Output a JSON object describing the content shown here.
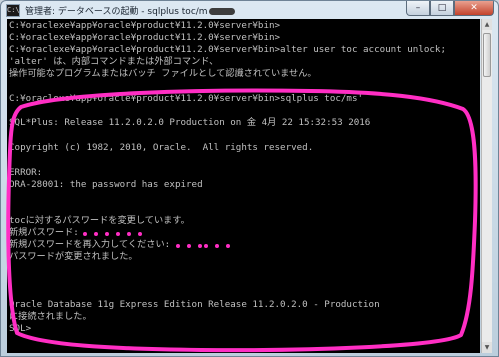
{
  "window": {
    "title": "管理者: データベースの起動 - sqlplus  toc/m",
    "icon_label": "C:\\",
    "buttons": {
      "minimize": "–",
      "maximize": "□",
      "close": "✕"
    }
  },
  "console": {
    "lines": [
      "C:¥oraclexe¥app¥oracle¥product¥11.2.0¥server¥bin>",
      "C:¥oraclexe¥app¥oracle¥product¥11.2.0¥server¥bin>",
      "C:¥oraclexe¥app¥oracle¥product¥11.2.0¥server¥bin>alter user toc account unlock;",
      "'alter' は、内部コマンドまたは外部コマンド、",
      "操作可能なプログラムまたはバッチ ファイルとして認識されていません。",
      "",
      "C:¥oraclexe¥app¥oracle¥product¥11.2.0¥server¥bin>sqlplus toc/ms'",
      "",
      "SQL*Plus: Release 11.2.0.2.0 Production on 金 4月 22 15:32:53 2016",
      "",
      "Copyright (c) 1982, 2010, Oracle.  All rights reserved.",
      "",
      "ERROR:",
      "ORA-28001: the password has expired",
      "",
      "",
      "tocに対するパスワードを変更しています。",
      "新規パスワード:",
      "新規パスワードを再入力してください:",
      "パスワードが変更されました。",
      "",
      "",
      "",
      "Oracle Database 11g Express Edition Release 11.2.0.2.0 - Production",
      "に接続されました。",
      "SQL>"
    ]
  },
  "scrollbar": {
    "up_arrow": "▲",
    "down_arrow": "▼"
  },
  "colors": {
    "console_background": "#000000",
    "console_text": "#c0c0c0",
    "annotation": "#ff2ec4"
  }
}
